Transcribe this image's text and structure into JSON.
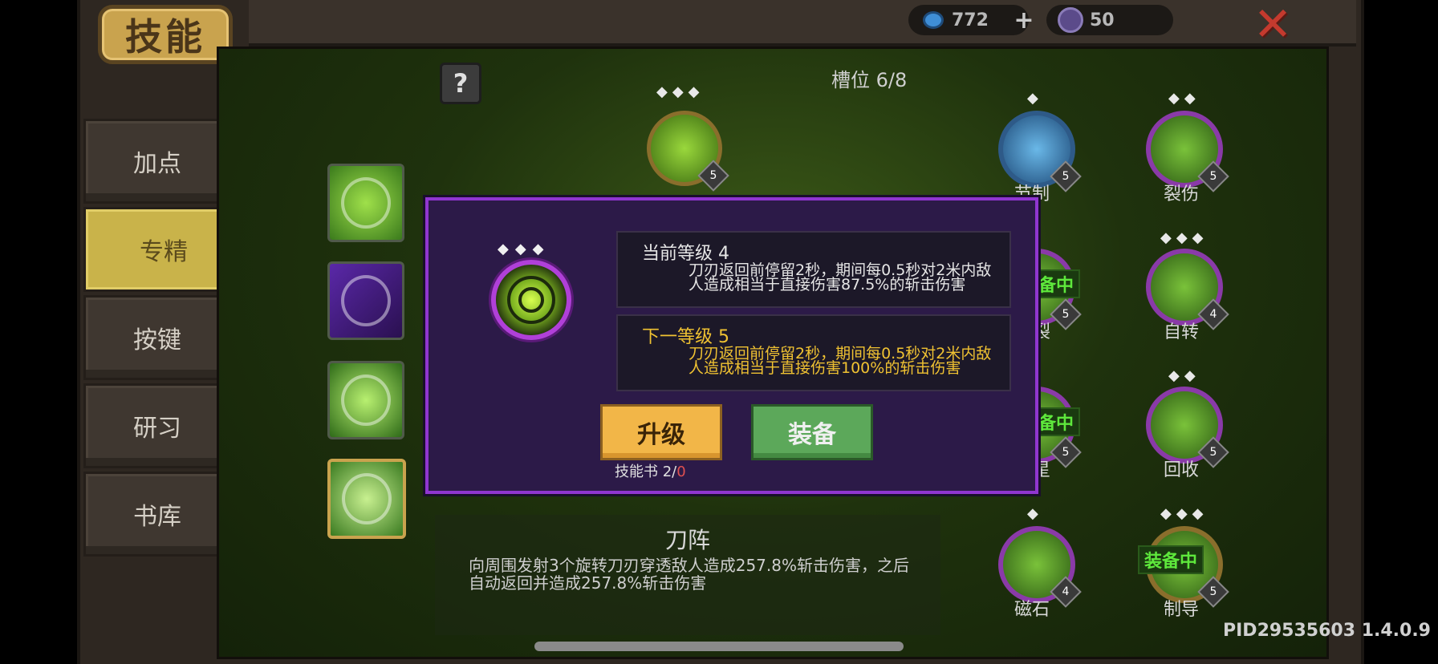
{
  "header": {
    "title": "技能",
    "currency1": "772",
    "currency2": "50",
    "plus": "+",
    "close": "✕"
  },
  "sidebar": {
    "items": [
      {
        "label": "加点"
      },
      {
        "label": "专精"
      },
      {
        "label": "按键"
      },
      {
        "label": "研习"
      },
      {
        "label": "书库"
      }
    ],
    "active_index": 1
  },
  "main": {
    "help": "?",
    "slot_label": "槽位 6/8",
    "center_diamonds": "◆◆◆",
    "center_level": "5"
  },
  "right_skills": [
    {
      "name": "节制",
      "level": "5",
      "diamonds": "◆"
    },
    {
      "name": "裂伤",
      "level": "5",
      "diamonds": "◆◆"
    },
    {
      "name": "裂",
      "level": "5",
      "diamonds": ""
    },
    {
      "name": "自转",
      "level": "4",
      "diamonds": "◆◆◆"
    },
    {
      "name": "星",
      "level": "5",
      "diamonds": ""
    },
    {
      "name": "回收",
      "level": "5",
      "diamonds": "◆◆"
    },
    {
      "name": "磁石",
      "level": "4",
      "diamonds": "◆"
    },
    {
      "name": "制导",
      "level": "5",
      "diamonds": "◆◆◆"
    }
  ],
  "equipped_tag": "装备中",
  "equipped_tag_partial": "备中",
  "skill_info": {
    "name": "刀阵",
    "desc": "向周围发射3个旋转刀刃穿透敌人造成257.8%斩击伤害，之后自动返回并造成257.8%斩击伤害"
  },
  "dialog": {
    "diamonds": "◆◆◆",
    "current_title": "当前等级 4",
    "current_text": "刀刃返回前停留2秒，期间每0.5秒对2米内敌人造成相当于直接伤害87.5%的斩击伤害",
    "next_title": "下一等级 5",
    "next_text": "刀刃返回前停留2秒，期间每0.5秒对2米内敌人造成相当于直接伤害100%的斩击伤害",
    "upgrade_label": "升级",
    "equip_label": "装备",
    "book_label": "技能书 2/",
    "book_count": "0"
  },
  "footer": {
    "pid": "PID29535603 1.4.0.9"
  },
  "colors": {
    "accent_gold": "#c9a34e",
    "dialog_border": "#9036d0",
    "next_level_text": "#f0c232",
    "upgrade_button": "#f2b648",
    "equip_button": "#5ca85a"
  }
}
